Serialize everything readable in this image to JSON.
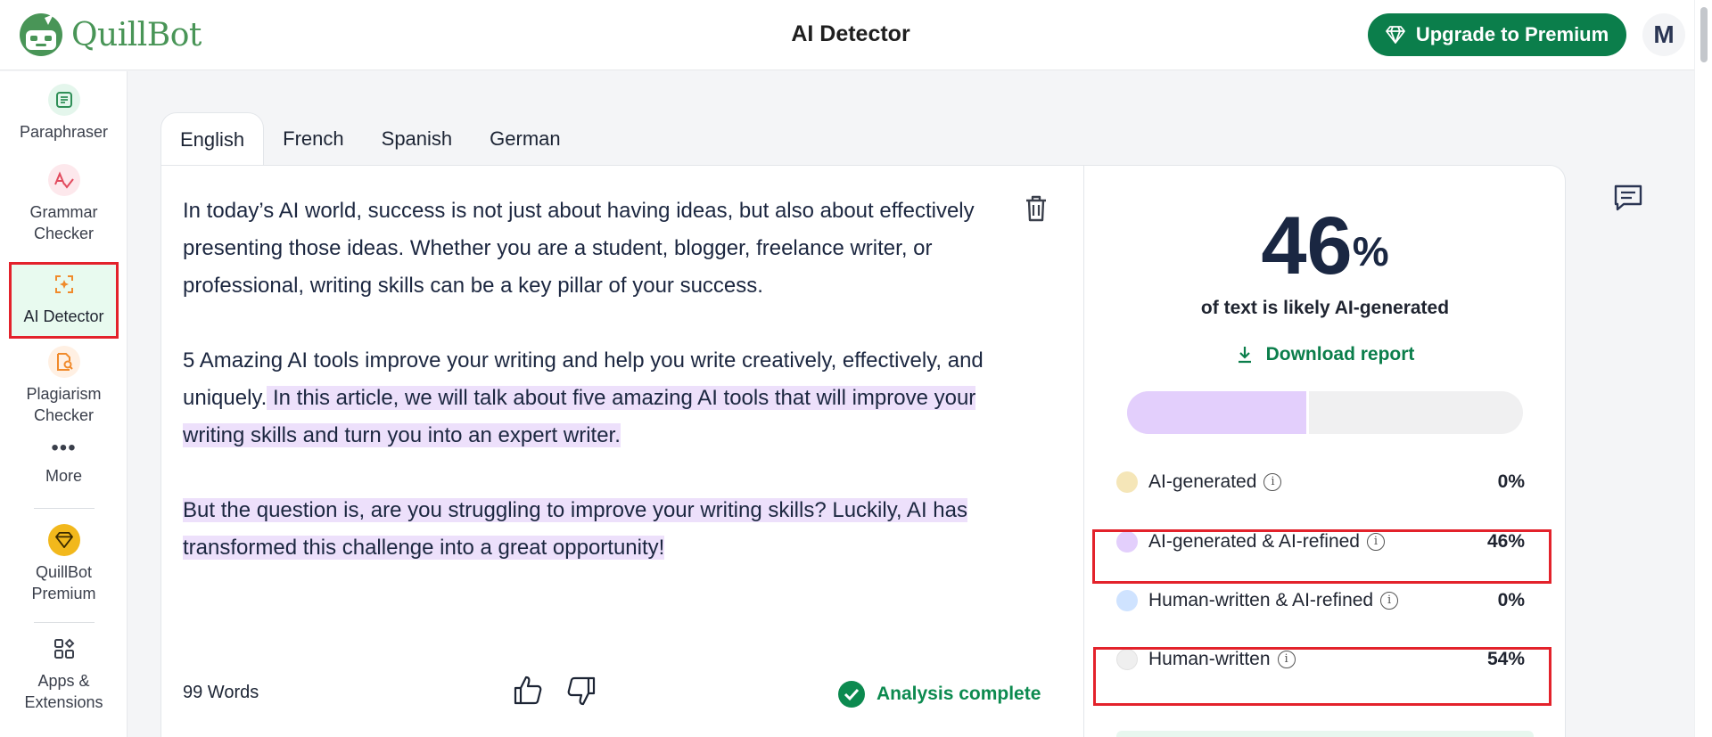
{
  "app": {
    "name": "QuillBot",
    "page_title": "AI Detector"
  },
  "header": {
    "upgrade_label": "Upgrade to Premium",
    "avatar_initial": "M"
  },
  "sidebar": {
    "items": [
      {
        "line1": "Paraphraser",
        "line2": "",
        "icon": "paraphraser-icon"
      },
      {
        "line1": "Grammar",
        "line2": "Checker",
        "icon": "grammar-checker-icon"
      },
      {
        "line1": "AI Detector",
        "line2": "",
        "icon": "ai-detector-icon"
      },
      {
        "line1": "Plagiarism",
        "line2": "Checker",
        "icon": "plagiarism-checker-icon"
      },
      {
        "line1": "More",
        "line2": "",
        "icon": "more-dots-icon"
      },
      {
        "line1": "QuillBot",
        "line2": "Premium",
        "icon": "diamond-icon"
      },
      {
        "line1": "Apps &",
        "line2": "Extensions",
        "icon": "apps-grid-icon"
      }
    ]
  },
  "tabs": [
    "English",
    "French",
    "Spanish",
    "German"
  ],
  "editor": {
    "p1": "In today’s AI world, success is not just about having ideas, but also about effectively presenting those ideas. Whether you are a student, blogger, freelance writer, or professional, writing skills can be a key pillar of your success.",
    "p2_plain": "5 Amazing AI tools improve your writing and help you write creatively, effectively, and uniquely.",
    "p2_highlight": " In this article, we will talk about five amazing AI tools that will improve your writing skills and turn you into an expert writer.",
    "p3_highlight": "But the question is, are you struggling to improve your writing skills? Luckily, AI has transformed this challenge into a great opportunity!",
    "word_count": "99 Words",
    "status": "Analysis complete"
  },
  "result": {
    "percent": "46",
    "percent_sign": "%",
    "caption": "of text is likely AI-generated",
    "download_label": "Download report",
    "ai_fraction": 0.46,
    "legend": [
      {
        "label": "AI-generated",
        "value": "0%",
        "color": "#f5e6b8"
      },
      {
        "label": "AI-generated & AI-refined",
        "value": "46%",
        "color": "#e3cffc"
      },
      {
        "label": "Human-written & AI-refined",
        "value": "0%",
        "color": "#cfe3ff"
      },
      {
        "label": "Human-written",
        "value": "54%",
        "color": "#efefef"
      }
    ]
  },
  "colors": {
    "brand_green": "#0b7e4b",
    "highlight": "#ede0fb",
    "annotation_red": "#e3222b"
  }
}
